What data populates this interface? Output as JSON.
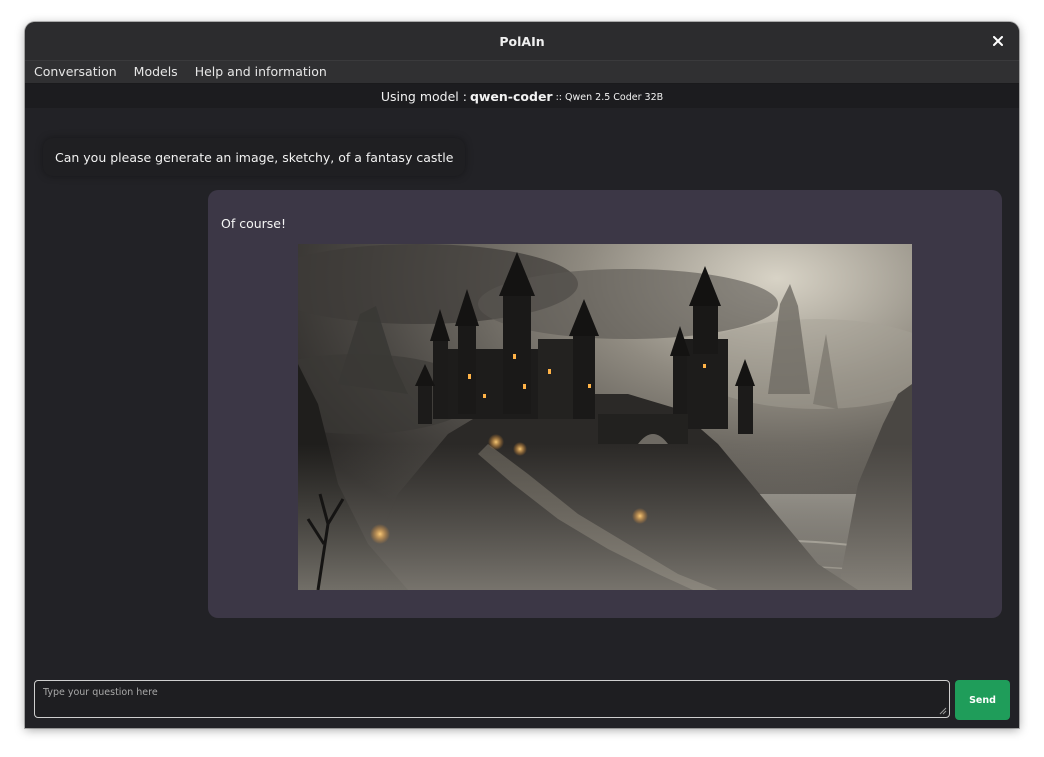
{
  "window": {
    "title": "PolAIn"
  },
  "menubar": {
    "items": [
      {
        "label": "Conversation"
      },
      {
        "label": "Models"
      },
      {
        "label": "Help and information"
      }
    ]
  },
  "model_bar": {
    "prefix": "Using model :",
    "model_name": "qwen-coder",
    "model_description": ":: Qwen 2.5 Coder 32B"
  },
  "conversation": {
    "user_message": "Can you please generate an image, sketchy, of a fantasy castle",
    "assistant_message": "Of course!",
    "assistant_image": "fantasy-castle-image"
  },
  "composer": {
    "placeholder": "Type your question here",
    "value": "",
    "send_label": "Send"
  },
  "colors": {
    "window_bg": "#222226",
    "assistant_bubble": "#3c3746",
    "send_button": "#1f9d5a"
  },
  "icons": {
    "close": "close-icon",
    "resize": "resize-grip-icon"
  }
}
